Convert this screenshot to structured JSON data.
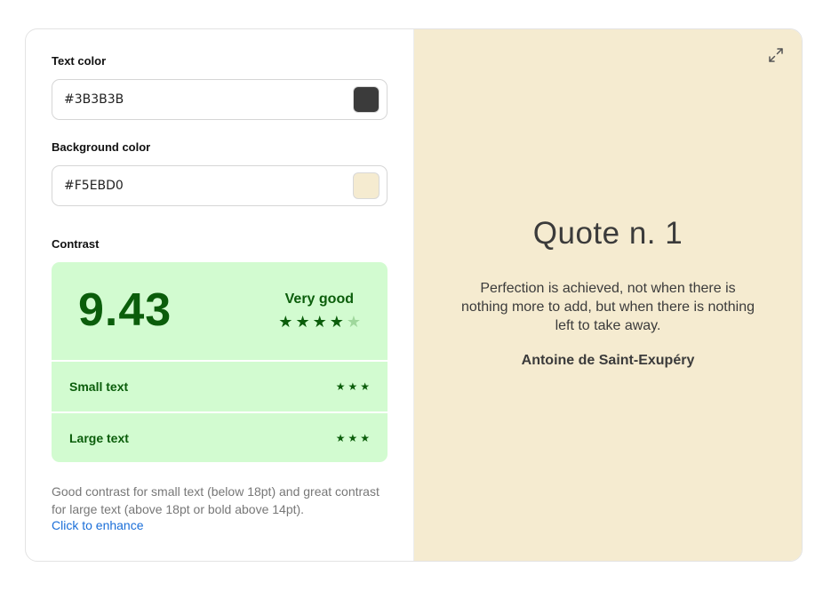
{
  "inputs": {
    "text_color": {
      "label": "Text color",
      "value": "#3B3B3B"
    },
    "background_color": {
      "label": "Background color",
      "value": "#F5EBD0"
    }
  },
  "contrast": {
    "label": "Contrast",
    "ratio": "9.43",
    "rating_label": "Very good",
    "rating": 4,
    "rating_max": 5,
    "rows": [
      {
        "label": "Small text",
        "stars": 3
      },
      {
        "label": "Large text",
        "stars": 3
      }
    ],
    "description": "Good contrast for small text (below 18pt) and great contrast for large text (above 18pt or bold above 14pt).",
    "enhance_link": "Click to enhance"
  },
  "preview": {
    "title": "Quote n. 1",
    "quote": "Perfection is achieved, not when there is nothing more to add, but when there is nothing left to take away.",
    "author": "Antoine de Saint-Exupéry",
    "expand_icon": "expand-icon"
  },
  "colors": {
    "text": "#3B3B3B",
    "background": "#F5EBD0",
    "good_bg": "#d2fbd0",
    "good_fg": "#0b5d0b",
    "link": "#1a6ed8"
  }
}
